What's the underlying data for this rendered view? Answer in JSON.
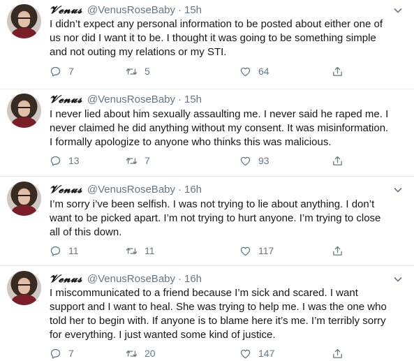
{
  "tweets": [
    {
      "name": "𝓥𝓮𝓷𝓾𝓼",
      "handle": "@VenusRoseBaby",
      "separator": "·",
      "time": "15h",
      "line1": "I didn’t expect any personal information to be posted about either one of",
      "line2": "us nor did I want it to be. I thought it was going to be something simple",
      "line3": "and not outing my relations or my STI.",
      "line4": "",
      "replies": "7",
      "retweets": "5",
      "likes": "64"
    },
    {
      "name": "𝓥𝓮𝓷𝓾𝓼",
      "handle": "@VenusRoseBaby",
      "separator": "·",
      "time": "15h",
      "line1": "I never lied about him sexually assaulting me. I never said he raped me. I",
      "line2": "never claimed he did anything without my consent. It was misinformation.",
      "line3": "I formally apologize to anyone who thinks this was malicious.",
      "line4": "",
      "replies": "13",
      "retweets": "7",
      "likes": "93"
    },
    {
      "name": "𝓥𝓮𝓷𝓾𝓼",
      "handle": "@VenusRoseBaby",
      "separator": "·",
      "time": "16h",
      "line1": "I’m sorry i’ve been selfish. I was not trying to lie about anything. I don’t",
      "line2": "want to be picked apart. I’m not trying to hurt anyone. I’m trying to close",
      "line3": "all of this down.",
      "line4": "",
      "replies": "11",
      "retweets": "11",
      "likes": "117"
    },
    {
      "name": "𝓥𝓮𝓷𝓾𝓼",
      "handle": "@VenusRoseBaby",
      "separator": "·",
      "time": "16h",
      "line1": "I miscommunicated to a friend because I’m sick and scared. I want",
      "line2": "support and I want to heal. She was trying to help me. I was the one who",
      "line3": "told her to begin with. If anyone is to blame here it’s me. I’m terribly sorry",
      "line4": "for everything. I just wanted some kind of justice.",
      "replies": "7",
      "retweets": "20",
      "likes": "147"
    }
  ],
  "colors": {
    "text": "#14171a",
    "secondary": "#657786",
    "divider": "#e6ecf0"
  }
}
